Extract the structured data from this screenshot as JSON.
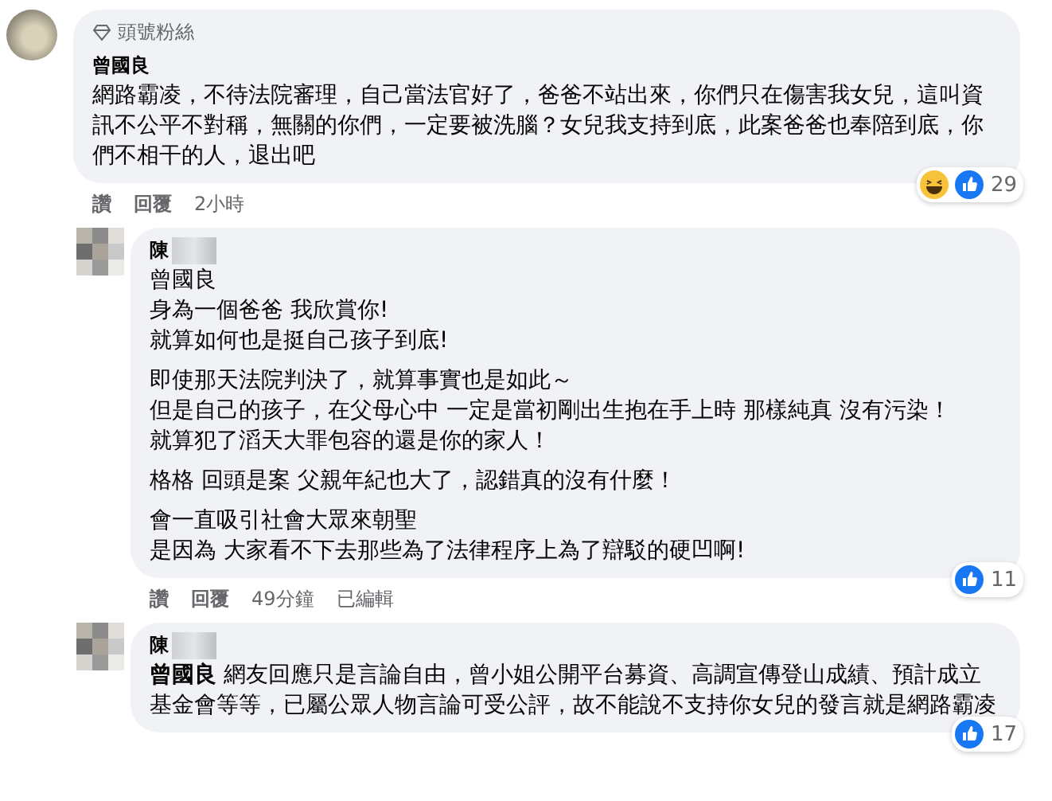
{
  "comments": [
    {
      "reply": false,
      "avatar": {
        "kind": "photo"
      },
      "badge": "頭號粉絲",
      "author": "曾國良",
      "author_blurred": false,
      "paragraphs": [
        [
          "網路霸凌，不待法院審理，自己當法官好了，爸爸不站出來，你們只在傷害我女兒，這叫資訊不公平不對稱，無關的你們，一定要被洗腦？女兒我支持到底，此案爸爸也奉陪到底，你們不相干的人，退出吧"
        ]
      ],
      "actions": [
        "讚",
        "回覆"
      ],
      "time": "2小時",
      "reactions": {
        "icons": [
          {
            "kind": "haha"
          },
          {
            "kind": "like"
          }
        ],
        "count": "29"
      }
    },
    {
      "reply": true,
      "avatar": {
        "kind": "blurred"
      },
      "author": "陳",
      "author_blurred": true,
      "paragraphs": [
        [
          "曾國良",
          "身為一個爸爸 我欣賞你!",
          "就算如何也是挺自己孩子到底!"
        ],
        [
          "即使那天法院判決了，就算事實也是如此～",
          "但是自己的孩子，在父母心中 一定是當初剛出生抱在手上時 那樣純真 沒有污染！",
          "就算犯了滔天大罪包容的還是你的家人！"
        ],
        [
          "格格 回頭是案 父親年紀也大了，認錯真的沒有什麼！"
        ],
        [
          "會一直吸引社會大眾來朝聖",
          "是因為 大家看不下去那些為了法律程序上為了辯駁的硬凹啊!"
        ]
      ],
      "actions": [
        "讚",
        "回覆"
      ],
      "time": "49分鐘",
      "edited": "已編輯",
      "reactions": {
        "icons": [
          {
            "kind": "like"
          }
        ],
        "count": "11"
      }
    },
    {
      "reply": true,
      "avatar": {
        "kind": "blurred"
      },
      "author": "陳",
      "author_blurred": true,
      "paragraphs": [
        [
          "**曾國良** 網友回應只是言論自由，曾小姐公開平台募資、高調宣傳登山成績、預計成立基金會等等，已屬公眾人物言論可受公評，故不能說不支持你女兒的發言就是網路霸凌"
        ]
      ],
      "reactions": {
        "icons": [
          {
            "kind": "like"
          }
        ],
        "count": "17"
      }
    }
  ]
}
